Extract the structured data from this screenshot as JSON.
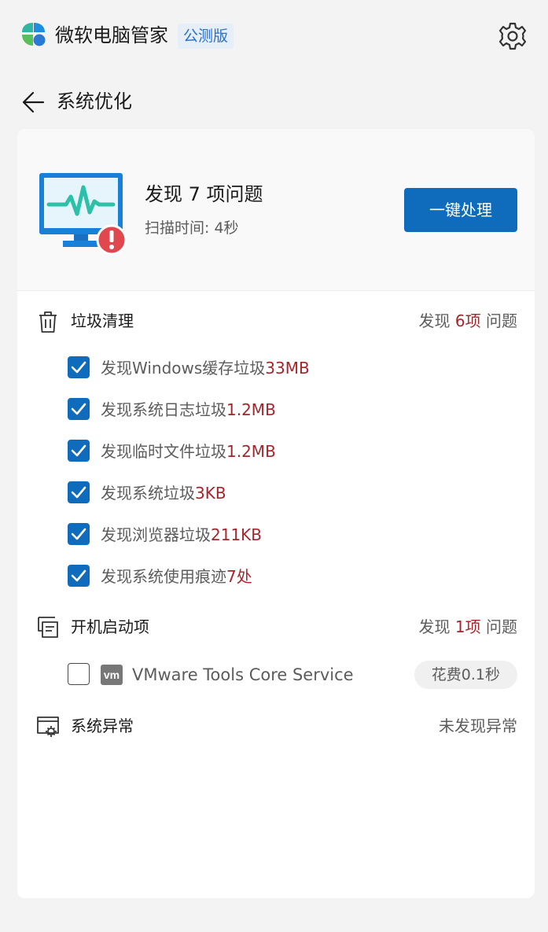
{
  "app": {
    "title": "微软电脑管家",
    "badge": "公测版",
    "logo_colors": [
      "#2db7a3",
      "#1e8fe0",
      "#55c05a",
      "#2a7ad5"
    ]
  },
  "header": {
    "back_icon": "arrow-left-icon",
    "page_title": "系统优化",
    "settings_icon": "gear-icon"
  },
  "summary": {
    "title": "发现 7 项问题",
    "scan_time": "扫描时间: 4秒",
    "fix_button": "一键处理",
    "icon": "monitor-alert-icon",
    "accent_color": "#0f6cbd",
    "alert_color": "#e0484e"
  },
  "sections": {
    "junk": {
      "icon": "trash-icon",
      "title": "垃圾清理",
      "status_prefix": "发现 ",
      "status_count": "6项",
      "status_suffix": " 问题",
      "items": [
        {
          "text": "发现Windows缓存垃圾",
          "value": "33MB",
          "checked": true
        },
        {
          "text": "发现系统日志垃圾",
          "value": "1.2MB",
          "checked": true
        },
        {
          "text": "发现临时文件垃圾",
          "value": "1.2MB",
          "checked": true
        },
        {
          "text": "发现系统垃圾",
          "value": "3KB",
          "checked": true
        },
        {
          "text": "发现浏览器垃圾",
          "value": "211KB",
          "checked": true
        },
        {
          "text": "发现系统使用痕迹",
          "value": "7处",
          "checked": true
        }
      ]
    },
    "startup": {
      "icon": "startup-apps-icon",
      "title": "开机启动项",
      "status_prefix": "发现 ",
      "status_count": "1项",
      "status_suffix": " 问题",
      "items": [
        {
          "icon_text": "vm",
          "text": "VMware Tools Core Service",
          "time": "花费0.1秒",
          "checked": false
        }
      ]
    },
    "system": {
      "icon": "system-settings-icon",
      "title": "系统异常",
      "status": "未发现异常"
    }
  }
}
